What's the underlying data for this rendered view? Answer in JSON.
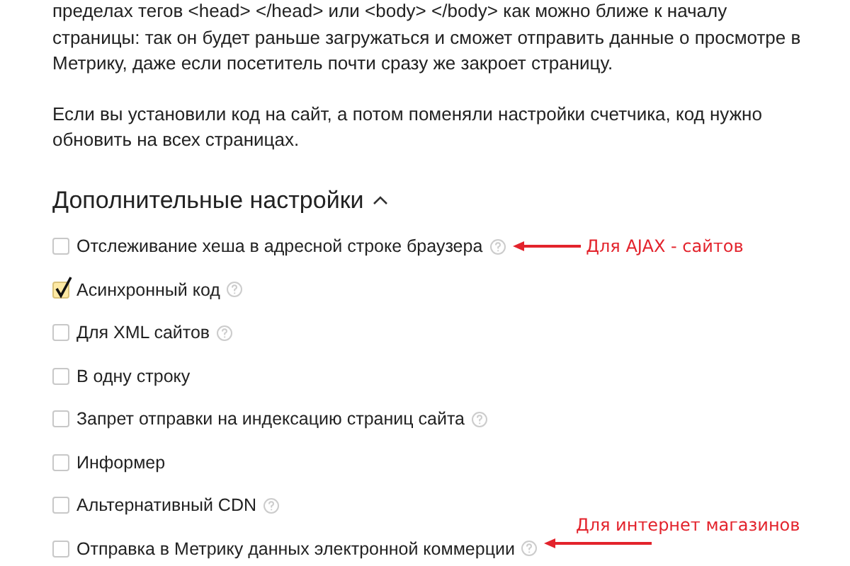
{
  "paragraphs": [
    "пределах тегов <head> </head> или <body> </body> как можно ближе к началу\nстраницы: так он будет раньше загружаться и сможет отправить данные о просмотре в\nМетрику, даже если посетитель почти сразу же закроет страницу.",
    "Если вы установили код на сайт, а потом поменяли настройки счетчика, код нужно\nобновить на всех страницах."
  ],
  "section": {
    "title": "Дополнительные настройки",
    "expanded": true
  },
  "options": [
    {
      "label": "Отслеживание хеша в адресной строке браузера",
      "checked": false,
      "help": true,
      "annotation": "Для AJAX - сайтов"
    },
    {
      "label": "Асинхронный код",
      "checked": true,
      "help": true
    },
    {
      "label": "Для XML сайтов",
      "checked": false,
      "help": true
    },
    {
      "label": "В одну строку",
      "checked": false,
      "help": false
    },
    {
      "label": "Запрет отправки на индексацию страниц сайта",
      "checked": false,
      "help": true
    },
    {
      "label": "Информер",
      "checked": false,
      "help": false
    },
    {
      "label": "Альтернативный CDN",
      "checked": false,
      "help": true
    },
    {
      "label": "Отправка в Метрику данных электронной коммерции",
      "checked": false,
      "help": true,
      "annotation": "Для интернет магазинов"
    }
  ]
}
